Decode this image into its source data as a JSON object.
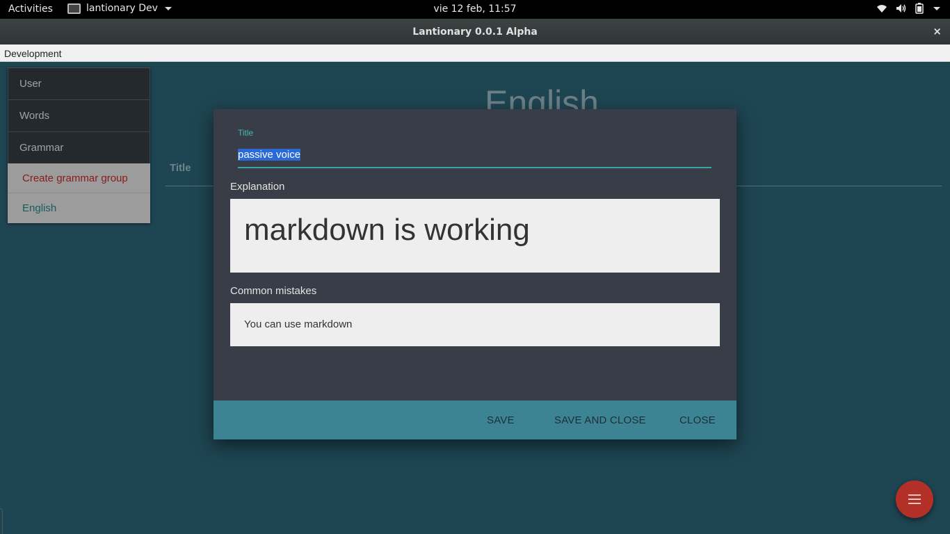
{
  "topbar": {
    "activities": "Activities",
    "app_name": "lantionary Dev",
    "clock": "vie 12 feb, 11:57",
    "tray_icons": [
      "wifi-icon",
      "volume-icon",
      "battery-icon",
      "system-menu-caret"
    ]
  },
  "window": {
    "title": "Lantionary 0.0.1 Alpha",
    "close": "×"
  },
  "menubar": {
    "items": [
      "Development"
    ]
  },
  "sidebar": {
    "items": [
      "User",
      "Words",
      "Grammar"
    ],
    "sub_items": [
      "Create grammar group",
      "English"
    ]
  },
  "background_page": {
    "heading": "English",
    "column_title": "Title"
  },
  "dialog": {
    "title_label": "Title",
    "title_value": "passive voice",
    "explanation_label": "Explanation",
    "explanation_preview": "markdown is working",
    "mistakes_label": "Common mistakes",
    "mistakes_preview": "You can use markdown",
    "buttons": {
      "save": "SAVE",
      "save_and_close": "SAVE AND CLOSE",
      "close": "CLOSE"
    }
  },
  "colors": {
    "app_bg": "#1e4552",
    "dialog_bg": "#393d47",
    "accent_teal": "#3aa6a3",
    "actions_bar": "#3c8493",
    "fab": "#b23028"
  }
}
